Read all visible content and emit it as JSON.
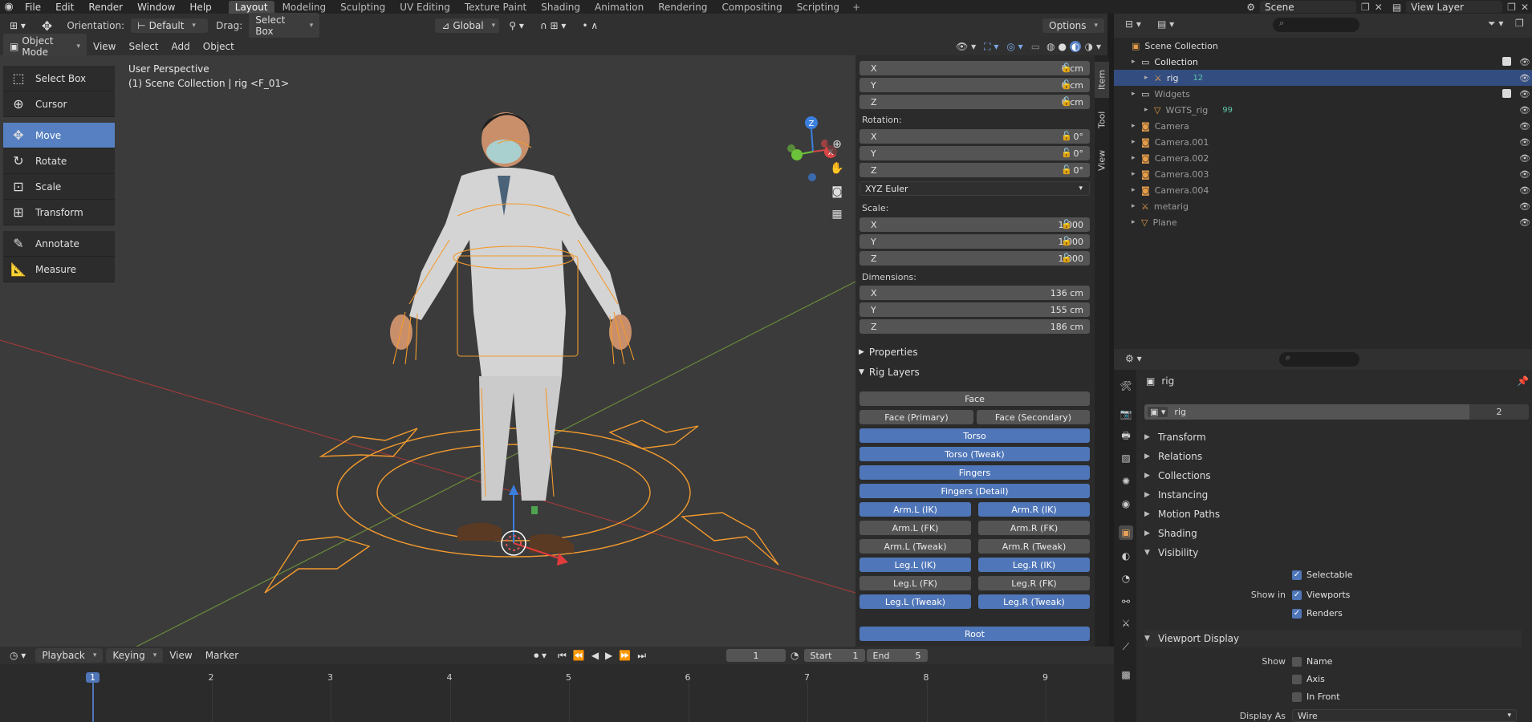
{
  "topbar": {
    "menus": [
      "File",
      "Edit",
      "Render",
      "Window",
      "Help"
    ],
    "workspaces": [
      "Layout",
      "Modeling",
      "Sculpting",
      "UV Editing",
      "Texture Paint",
      "Shading",
      "Animation",
      "Rendering",
      "Compositing",
      "Scripting"
    ],
    "active_workspace": "Layout",
    "scene_label": "Scene",
    "view_layer_label": "View Layer"
  },
  "vp_header": {
    "orientation_label": "Orientation:",
    "orientation_value": "Default",
    "drag_label": "Drag:",
    "drag_value": "Select Box",
    "transform_space": "Global",
    "options_label": "Options",
    "mode": "Object Mode",
    "menus": [
      "View",
      "Select",
      "Add",
      "Object"
    ]
  },
  "viewport": {
    "perspective_label": "User Perspective",
    "context_label": "(1) Scene Collection | rig <F_01>",
    "gizmo_axes": {
      "x": "X",
      "y": "Y",
      "z": "Z"
    }
  },
  "toolbar": {
    "tools": [
      "Select Box",
      "Cursor",
      "Move",
      "Rotate",
      "Scale",
      "Transform",
      "Annotate",
      "Measure"
    ],
    "active_tool": "Move"
  },
  "npanel": {
    "tabs": [
      "Item",
      "Tool",
      "View"
    ],
    "location": [
      {
        "axis": "X",
        "value": "0 cm"
      },
      {
        "axis": "Y",
        "value": "0 cm"
      },
      {
        "axis": "Z",
        "value": "0 cm"
      }
    ],
    "rotation_label": "Rotation:",
    "rotation": [
      {
        "axis": "X",
        "value": "0°"
      },
      {
        "axis": "Y",
        "value": "0°"
      },
      {
        "axis": "Z",
        "value": "0°"
      }
    ],
    "rotation_mode": "XYZ Euler",
    "scale_label": "Scale:",
    "scale": [
      {
        "axis": "X",
        "value": "1.000"
      },
      {
        "axis": "Y",
        "value": "1.000"
      },
      {
        "axis": "Z",
        "value": "1.000"
      }
    ],
    "dimensions_label": "Dimensions:",
    "dimensions": [
      {
        "axis": "X",
        "value": "136 cm"
      },
      {
        "axis": "Y",
        "value": "155 cm"
      },
      {
        "axis": "Z",
        "value": "186 cm"
      }
    ],
    "properties_label": "Properties",
    "rig_layers_label": "Rig Layers",
    "rig_layers": [
      {
        "label": "Face",
        "on": false
      },
      {
        "label": "Face (Primary)",
        "on": false
      },
      {
        "label": "Face (Secondary)",
        "on": false
      },
      {
        "label": "Torso",
        "on": true
      },
      {
        "label": "Torso (Tweak)",
        "on": true
      },
      {
        "label": "Fingers",
        "on": true
      },
      {
        "label": "Fingers (Detail)",
        "on": true
      },
      {
        "label": "Arm.L (IK)",
        "on": true
      },
      {
        "label": "Arm.R (IK)",
        "on": true
      },
      {
        "label": "Arm.L (FK)",
        "on": false
      },
      {
        "label": "Arm.R (FK)",
        "on": false
      },
      {
        "label": "Arm.L (Tweak)",
        "on": false
      },
      {
        "label": "Arm.R (Tweak)",
        "on": false
      },
      {
        "label": "Leg.L (IK)",
        "on": true
      },
      {
        "label": "Leg.R (IK)",
        "on": true
      },
      {
        "label": "Leg.L (FK)",
        "on": false
      },
      {
        "label": "Leg.R (FK)",
        "on": false
      },
      {
        "label": "Leg.L (Tweak)",
        "on": true
      },
      {
        "label": "Leg.R (Tweak)",
        "on": true
      },
      {
        "label": "Root",
        "on": true
      }
    ]
  },
  "outliner": {
    "root": "Scene Collection",
    "items": [
      {
        "label": "Collection",
        "kind": "collection"
      },
      {
        "label": "rig",
        "kind": "armature",
        "badge": "12"
      },
      {
        "label": "Widgets",
        "kind": "collection"
      },
      {
        "label": "WGTS_rig",
        "kind": "mesh",
        "badge": "99"
      },
      {
        "label": "Camera",
        "kind": "camera"
      },
      {
        "label": "Camera.001",
        "kind": "camera"
      },
      {
        "label": "Camera.002",
        "kind": "camera"
      },
      {
        "label": "Camera.003",
        "kind": "camera"
      },
      {
        "label": "Camera.004",
        "kind": "camera"
      },
      {
        "label": "metarig",
        "kind": "armature"
      },
      {
        "label": "Plane",
        "kind": "mesh"
      }
    ]
  },
  "properties": {
    "object_name": "rig",
    "datablock_name": "rig",
    "users": "2",
    "sections": [
      "Transform",
      "Relations",
      "Collections",
      "Instancing",
      "Motion Paths",
      "Shading",
      "Visibility"
    ],
    "visibility": {
      "selectable": "Selectable",
      "show_in_label": "Show in",
      "viewports": "Viewports",
      "renders": "Renders"
    },
    "viewport_display_label": "Viewport Display",
    "show_label": "Show",
    "show_options": [
      "Name",
      "Axis",
      "In Front"
    ],
    "display_as_label": "Display As",
    "display_as_value": "Wire"
  },
  "timeline": {
    "menus": [
      "Playback",
      "Keying",
      "View",
      "Marker"
    ],
    "current_frame": "1",
    "start_label": "Start",
    "start_value": "1",
    "end_label": "End",
    "end_value": "5",
    "frame_numbers": [
      "1",
      "2",
      "3",
      "4",
      "5",
      "6",
      "7",
      "8",
      "9"
    ]
  },
  "colors": {
    "accent": "#5680c2",
    "selection": "#334d80",
    "rig_orange": "#f29a2e"
  }
}
